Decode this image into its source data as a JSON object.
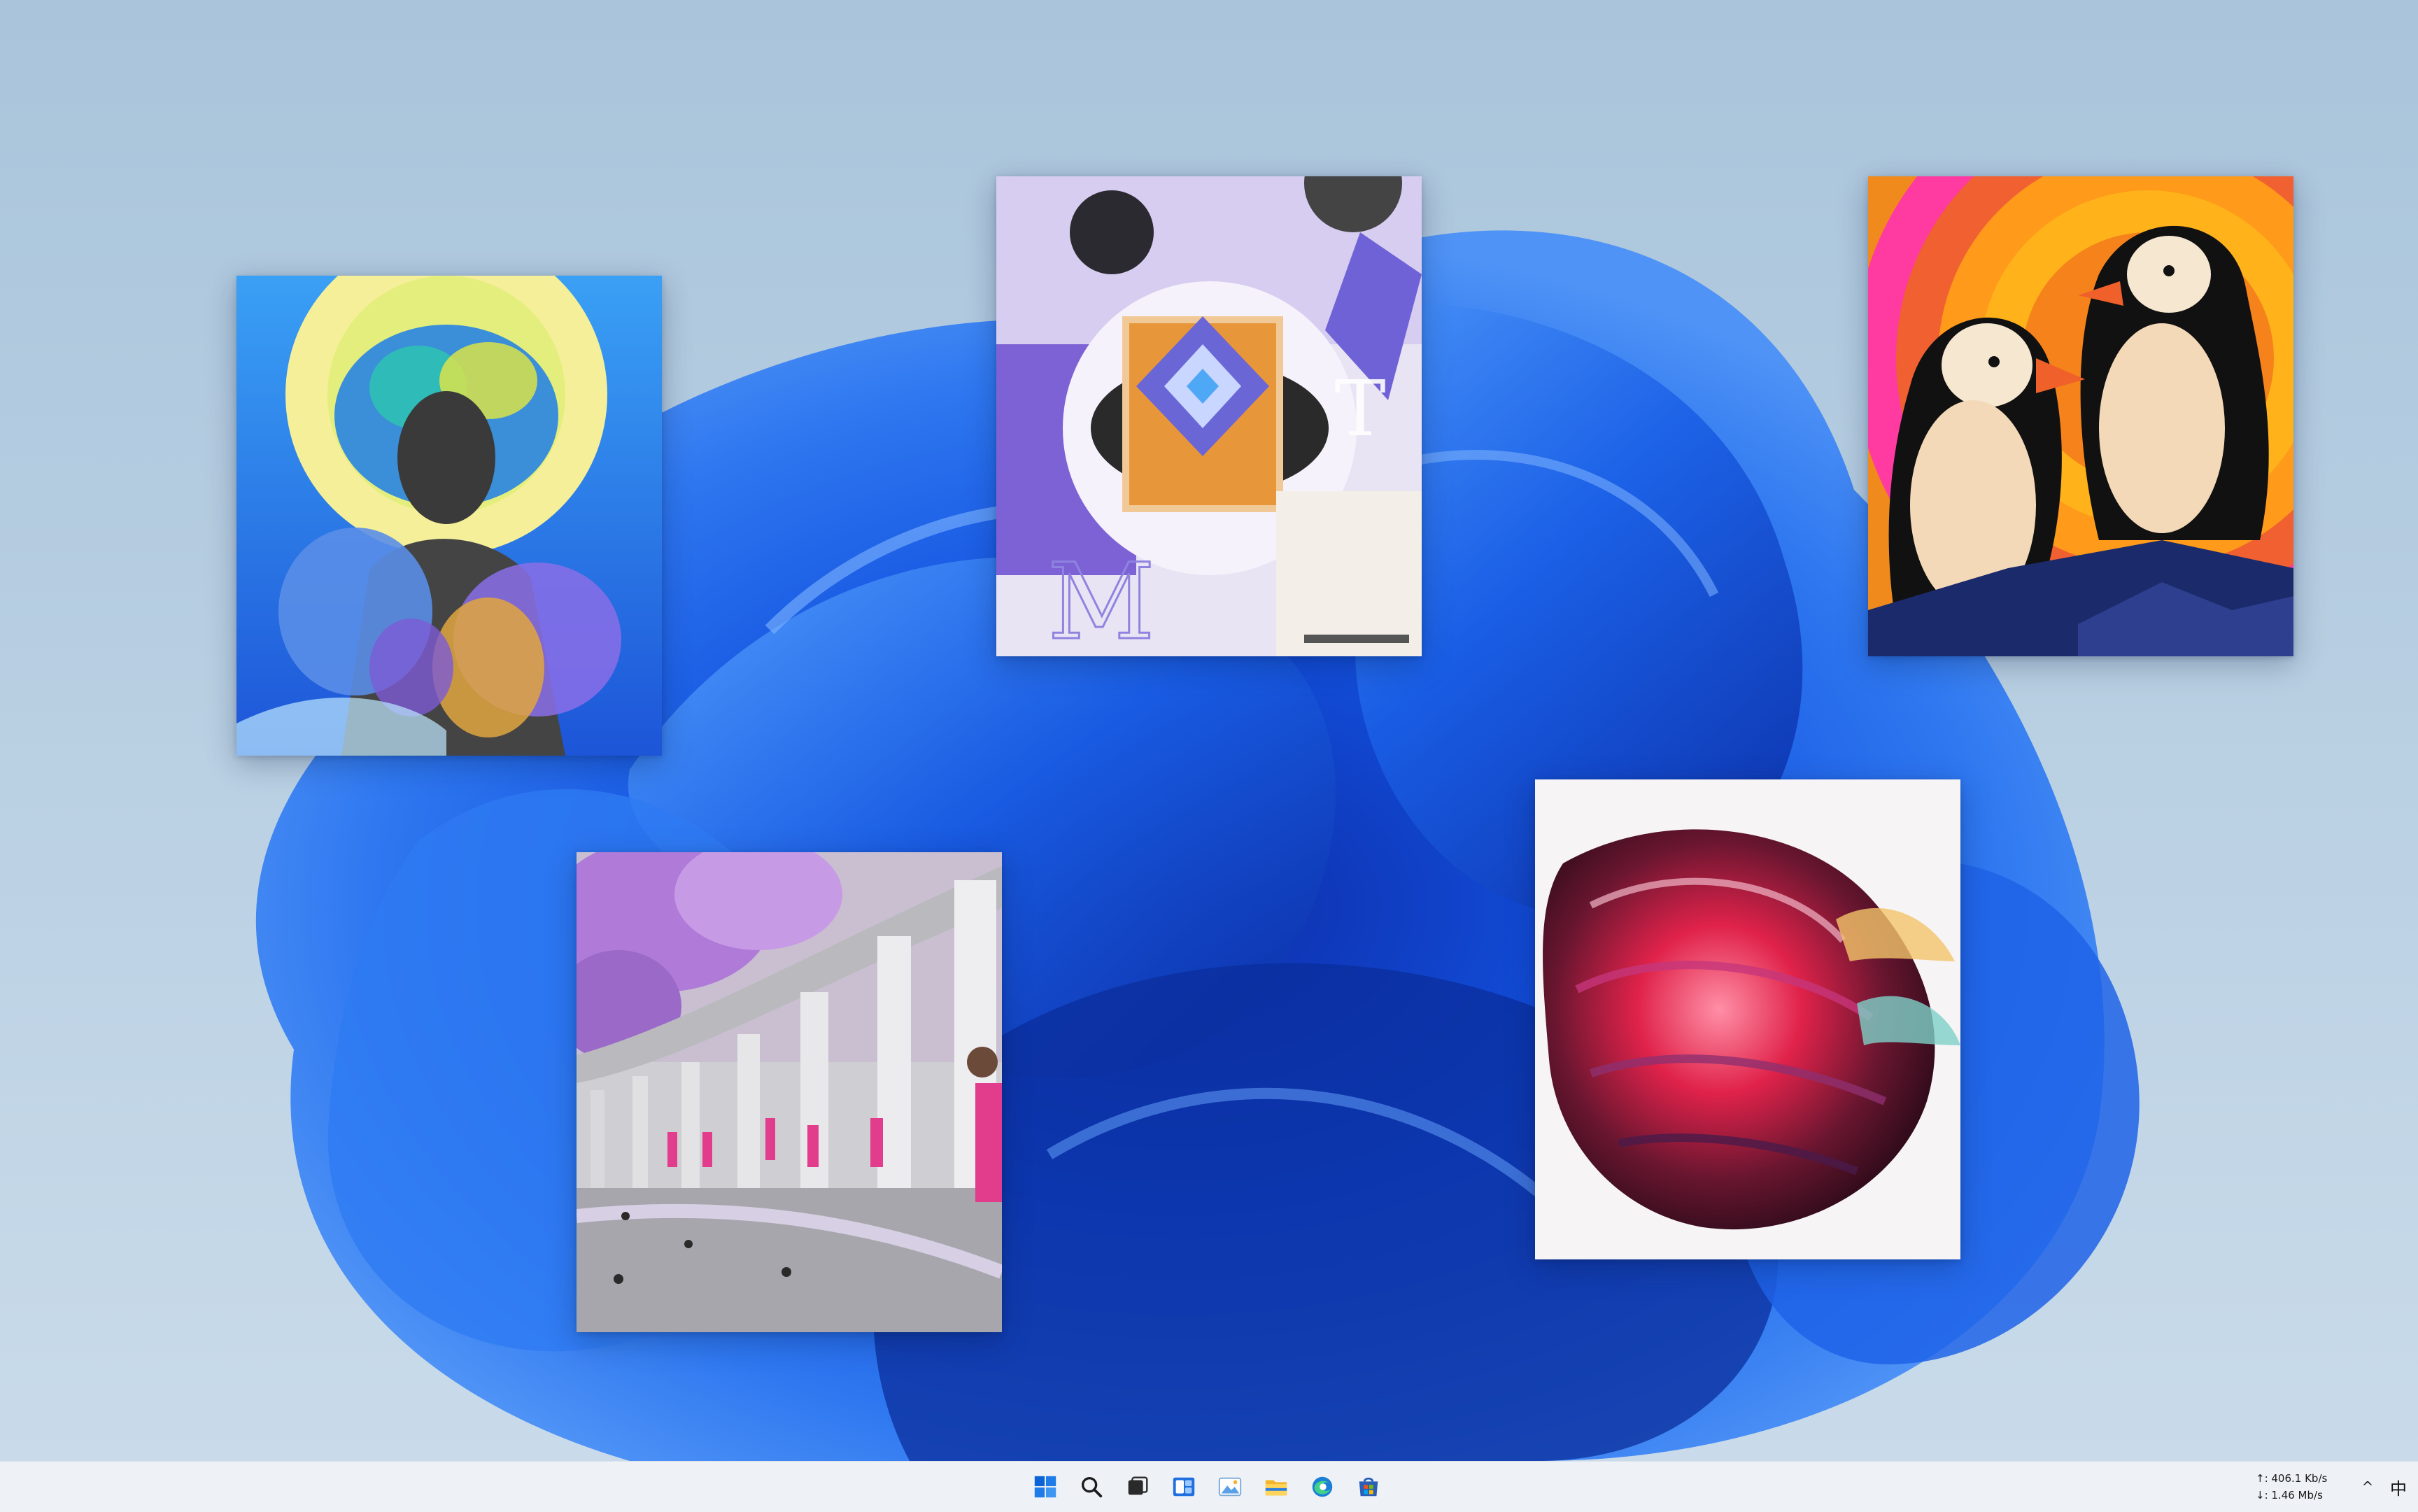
{
  "desktop": {
    "wallpaper": "bloom-wallpaper",
    "windows": [
      {
        "name": "portrait-art-window",
        "subject": "portrait-with-flowers"
      },
      {
        "name": "abstract-art-window",
        "subject": "abstract-geometric-letters"
      },
      {
        "name": "puffins-art-window",
        "subject": "puffins-illustration"
      },
      {
        "name": "colonnade-photo-window",
        "subject": "colonnade-pink-people"
      },
      {
        "name": "glass-rose-window",
        "subject": "abstract-rose-shape"
      }
    ]
  },
  "taskbar": {
    "icons": [
      {
        "name": "start-icon"
      },
      {
        "name": "search-icon"
      },
      {
        "name": "task-view-icon"
      },
      {
        "name": "widgets-icon"
      },
      {
        "name": "photos-icon"
      },
      {
        "name": "file-explorer-icon"
      },
      {
        "name": "edge-icon"
      },
      {
        "name": "store-icon"
      }
    ],
    "tray": {
      "upload_speed": "↑: 406.1 Kb/s",
      "download_speed": "↓: 1.46 Mb/s",
      "chevron": "^",
      "ime": "中"
    },
    "accent_color": "#0a64d8"
  }
}
